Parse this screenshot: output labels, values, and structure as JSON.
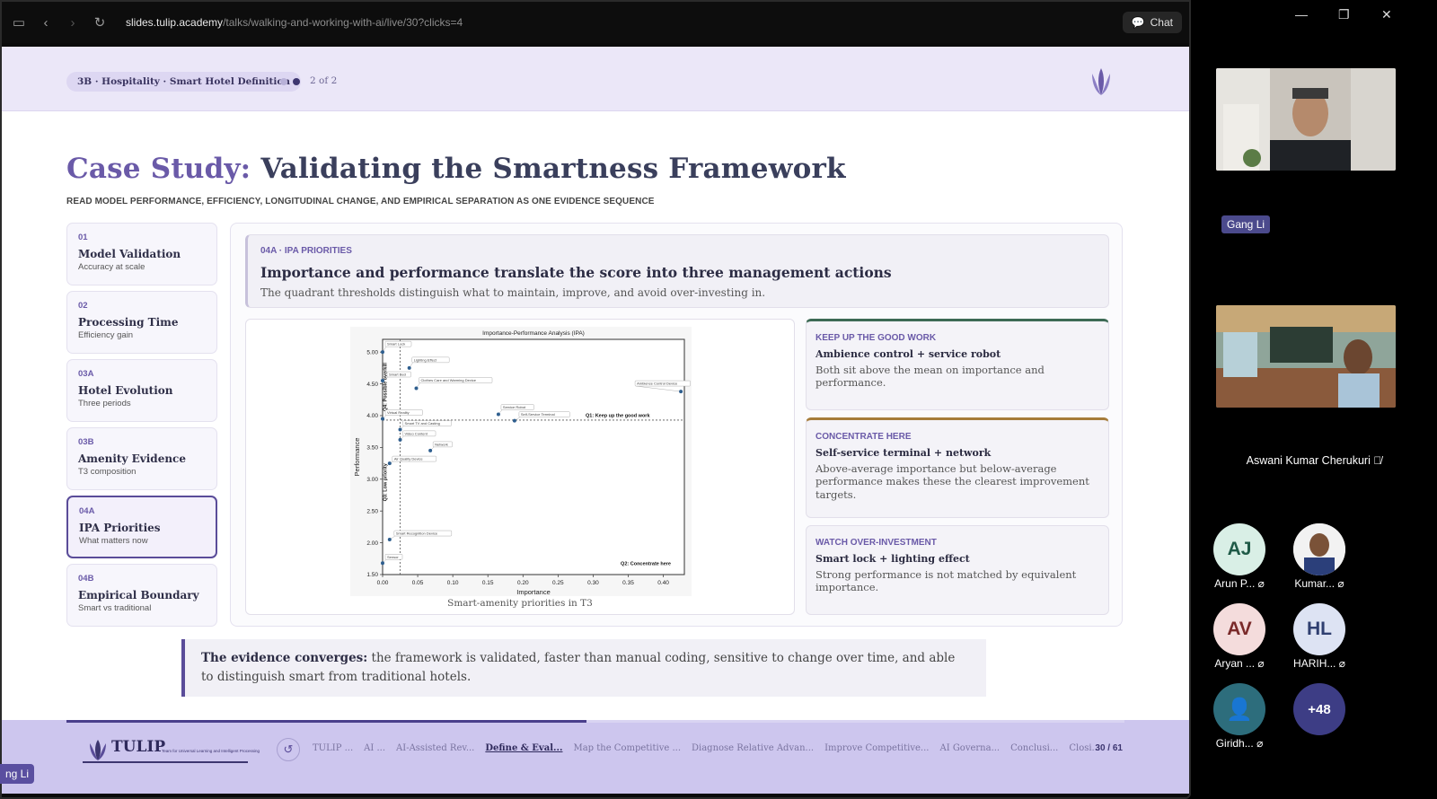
{
  "browser": {
    "url_host": "slides.tulip.academy",
    "url_path": "/talks/walking-and-working-with-ai/live/30?clicks=4",
    "chat_label": "Chat"
  },
  "slide": {
    "breadcrumb": "3B · Hospitality · Smart Hotel Definition",
    "page_count": "2 of 2",
    "title_accent": "Case Study:",
    "title_rest": "Validating the Smartness Framework",
    "subtitle": "READ MODEL PERFORMANCE, EFFICIENCY, LONGITUDINAL CHANGE, AND EMPIRICAL SEPARATION AS ONE EVIDENCE SEQUENCE",
    "nav": [
      {
        "num": "01",
        "name": "Model Validation",
        "sub": "Accuracy at scale"
      },
      {
        "num": "02",
        "name": "Processing Time",
        "sub": "Efficiency gain"
      },
      {
        "num": "03A",
        "name": "Hotel Evolution",
        "sub": "Three periods"
      },
      {
        "num": "03B",
        "name": "Amenity Evidence",
        "sub": "T3 composition"
      },
      {
        "num": "04A",
        "name": "IPA Priorities",
        "sub": "What matters now"
      },
      {
        "num": "04B",
        "name": "Empirical Boundary",
        "sub": "Smart vs traditional"
      }
    ],
    "card": {
      "tag": "04A · IPA PRIORITIES",
      "heading": "Importance and performance translate the score into three management actions",
      "text": "The quadrant thresholds distinguish what to maintain, improve, and avoid over-investing in."
    },
    "chart_caption": "Smart-amenity priorities in T3",
    "actions": [
      {
        "tag": "KEEP UP THE GOOD WORK",
        "heading": "Ambience control + service robot",
        "text": "Both sit above the mean on importance and performance."
      },
      {
        "tag": "CONCENTRATE HERE",
        "heading": "Self-service terminal + network",
        "text": "Above-average importance but below-average performance makes these the clearest improvement targets."
      },
      {
        "tag": "WATCH OVER-INVESTMENT",
        "heading": "Smart lock + lighting effect",
        "text": "Strong performance is not matched by equivalent importance."
      }
    ],
    "quote_bold": "The evidence converges:",
    "quote_text": " the framework is validated, faster than manual coding, sensitive to change over time, and able to distinguish smart from traditional hotels.",
    "footer": {
      "logo_word": "TULIP",
      "logo_tagline": "Team for Universal Learning and Intelligent Processing",
      "sections": [
        "TULIP ...",
        "AI ...",
        "AI-Assisted Rev...",
        "Define & Eval...",
        "Map the Competitive ...",
        "Diagnose Relative Advan...",
        "Improve Competitive...",
        "AI Governa...",
        "Conclusi...",
        "Closi..."
      ],
      "current_section": 3,
      "slide_num": "30 / 61",
      "progress": 0.4918
    }
  },
  "speaker_chip": "ng Li",
  "meeting": {
    "presenter_name": "Gang Li",
    "second_video_name": "Aswani Kumar Cherukuri",
    "participants": [
      {
        "initials": "AJ",
        "name": "Arun P...",
        "bg": "#d9efe6",
        "fg": "#1f5a47"
      },
      {
        "initials": "",
        "name": "Kumar...",
        "bg": "#e8e4de",
        "fg": "#333"
      },
      {
        "initials": "AV",
        "name": "Aryan ...",
        "bg": "#f4dcdc",
        "fg": "#7a2a2a"
      },
      {
        "initials": "HL",
        "name": "HARIH...",
        "bg": "#dde3f3",
        "fg": "#2f3f70"
      },
      {
        "initials": "",
        "name": "Giridh...",
        "bg": "#2d6d7c",
        "fg": "#fff"
      },
      {
        "initials": "+48",
        "name": "",
        "bg": "#3d3d85",
        "fg": "#fff"
      }
    ]
  },
  "chart_data": {
    "type": "scatter",
    "title": "Importance-Performance Analysis (IPA)",
    "xlabel": "Importance",
    "ylabel": "Performance",
    "xlim": [
      0.0,
      0.43
    ],
    "ylim": [
      1.5,
      5.2
    ],
    "x_ticks": [
      "0.00",
      "0.05",
      "0.10",
      "0.15",
      "0.20",
      "0.25",
      "0.30",
      "0.35",
      "0.40"
    ],
    "y_ticks": [
      "1.50",
      "2.00",
      "2.50",
      "3.00",
      "3.50",
      "4.00",
      "4.50",
      "5.00"
    ],
    "mean_importance": 0.025,
    "mean_performance": 3.93,
    "quadrant_labels": [
      "Q1: Keep up the good work",
      "Q2: Concentrate here",
      "Q3: Low priority",
      "Q4: Possible overkill"
    ],
    "points": [
      {
        "label": "Smart Lock",
        "x": 0.0,
        "y": 5.0
      },
      {
        "label": "Lighting Effect",
        "x": 0.038,
        "y": 4.75
      },
      {
        "label": "Smart Bed",
        "x": 0.0,
        "y": 4.55
      },
      {
        "label": "Clothes Care and Warming Device",
        "x": 0.048,
        "y": 4.43
      },
      {
        "label": "Ambience Control Device",
        "x": 0.425,
        "y": 4.38
      },
      {
        "label": "Service Robot",
        "x": 0.165,
        "y": 4.02
      },
      {
        "label": "Self-Service Terminal",
        "x": 0.188,
        "y": 3.92
      },
      {
        "label": "Virtual Reality",
        "x": 0.0,
        "y": 3.95
      },
      {
        "label": "Smart TV and Casting",
        "x": 0.025,
        "y": 3.78
      },
      {
        "label": "Video Content",
        "x": 0.025,
        "y": 3.62
      },
      {
        "label": "Network",
        "x": 0.068,
        "y": 3.45
      },
      {
        "label": "Air Quality Device",
        "x": 0.01,
        "y": 3.25
      },
      {
        "label": "Smart Recognition Device",
        "x": 0.01,
        "y": 2.05
      },
      {
        "label": "Sensor",
        "x": 0.0,
        "y": 1.68
      }
    ]
  }
}
